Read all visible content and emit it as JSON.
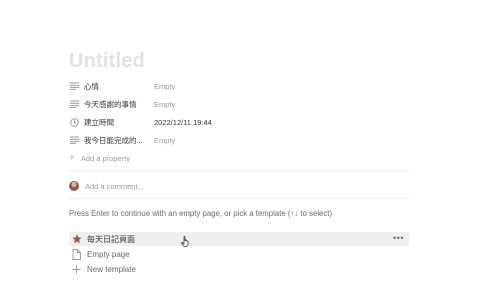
{
  "page": {
    "title": "Untitled"
  },
  "properties": [
    {
      "icon": "text-lines-icon",
      "name": "心情",
      "value": "Empty",
      "empty": true
    },
    {
      "icon": "text-lines-icon",
      "name": "今天感謝的事情",
      "value": "Empty",
      "empty": true
    },
    {
      "icon": "clock-icon",
      "name": "建立時間",
      "value": "2022/12/11 19:44",
      "empty": false
    },
    {
      "icon": "text-lines-icon",
      "name": "我今日能完成的...",
      "value": "Empty",
      "empty": true
    }
  ],
  "add_property": {
    "label": "Add a property"
  },
  "comment": {
    "placeholder": "Add a comment..."
  },
  "hint": "Press Enter to continue with an empty page, or pick a template (↑↓ to select)",
  "templates": [
    {
      "icon": "star-icon",
      "label": "每天日記頁面"
    },
    {
      "icon": "page-icon",
      "label": "Empty page"
    },
    {
      "icon": "plus-icon",
      "label": "New template"
    }
  ],
  "more_label": "•••",
  "colors": {
    "title_placeholder": "#e3e2e0",
    "star": "#a0554a",
    "highlight_bg": "#efefee"
  }
}
